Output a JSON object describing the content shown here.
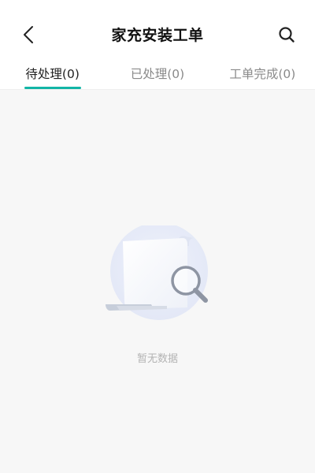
{
  "header": {
    "title": "家充安装工单",
    "back_icon": "chevron-left-icon",
    "search_icon": "search-icon"
  },
  "tabs": [
    {
      "label": "待处理(0)",
      "active": true
    },
    {
      "label": "已处理(0)",
      "active": false
    },
    {
      "label": "工单完成(0)",
      "active": false
    }
  ],
  "empty_state": {
    "message": "暂无数据",
    "illustration_icon": "document-search-icon"
  },
  "colors": {
    "accent": "#12b5a6",
    "background": "#f7f7f7",
    "muted_text": "#b3b3b3"
  }
}
